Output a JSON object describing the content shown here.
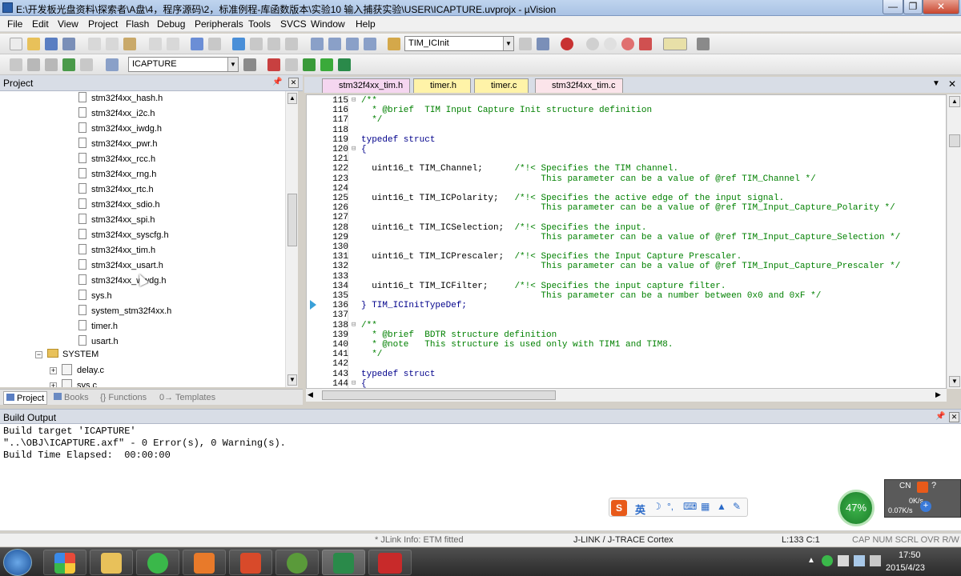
{
  "window": {
    "title": "E:\\开发板光盘资料\\探索者\\A盘\\4，程序源码\\2，标准例程-库函数版本\\实验10 输入捕获实验\\USER\\ICAPTURE.uvprojx - µVision",
    "controls": [
      "—",
      "❐",
      "✕"
    ]
  },
  "menu": [
    "File",
    "Edit",
    "View",
    "Project",
    "Flash",
    "Debug",
    "Peripherals",
    "Tools",
    "SVCS",
    "Window",
    "Help"
  ],
  "toolbar": {
    "find_combo": "TIM_ICInit",
    "target_combo": "ICAPTURE"
  },
  "project_panel": {
    "title": "Project",
    "files": [
      "stm32f4xx_hash.h",
      "stm32f4xx_i2c.h",
      "stm32f4xx_iwdg.h",
      "stm32f4xx_pwr.h",
      "stm32f4xx_rcc.h",
      "stm32f4xx_rng.h",
      "stm32f4xx_rtc.h",
      "stm32f4xx_sdio.h",
      "stm32f4xx_spi.h",
      "stm32f4xx_syscfg.h",
      "stm32f4xx_tim.h",
      "stm32f4xx_usart.h",
      "stm32f4xx_wwdg.h",
      "sys.h",
      "system_stm32f4xx.h",
      "timer.h",
      "usart.h"
    ],
    "folder": "SYSTEM",
    "subfiles": [
      "delay.c",
      "sys.c"
    ],
    "tabs": [
      "Project",
      "Books",
      "{} Functions",
      "0→ Templates"
    ]
  },
  "editor": {
    "tabs": [
      {
        "label": "stm32f4xx_tim.h",
        "color": "#f5d6f0"
      },
      {
        "label": "timer.h",
        "color": "#fff3a8"
      },
      {
        "label": "timer.c",
        "color": "#fff3a8"
      },
      {
        "label": "stm32f4xx_tim.c",
        "color": "#fbe4ea"
      }
    ],
    "line_numbers": [
      "115",
      "116",
      "117",
      "118",
      "119",
      "120",
      "121",
      "122",
      "123",
      "124",
      "125",
      "126",
      "127",
      "128",
      "129",
      "130",
      "131",
      "132",
      "133",
      "134",
      "135",
      "136",
      "137",
      "138",
      "139",
      "140",
      "141",
      "142",
      "143",
      "144"
    ],
    "lines": [
      "/**",
      "  * @brief  TIM Input Capture Init structure definition",
      "  */",
      "",
      "typedef struct",
      "{",
      "",
      "  uint16_t TIM_Channel;      /*!< Specifies the TIM channel.",
      "                                  This parameter can be a value of @ref TIM_Channel */",
      "",
      "  uint16_t TIM_ICPolarity;   /*!< Specifies the active edge of the input signal.",
      "                                  This parameter can be a value of @ref TIM_Input_Capture_Polarity */",
      "",
      "  uint16_t TIM_ICSelection;  /*!< Specifies the input.",
      "                                  This parameter can be a value of @ref TIM_Input_Capture_Selection */",
      "",
      "  uint16_t TIM_ICPrescaler;  /*!< Specifies the Input Capture Prescaler.",
      "                                  This parameter can be a value of @ref TIM_Input_Capture_Prescaler */",
      "",
      "  uint16_t TIM_ICFilter;     /*!< Specifies the input capture filter.",
      "                                  This parameter can be a number between 0x0 and 0xF */",
      "} TIM_ICInitTypeDef;",
      "",
      "/**",
      "  * @brief  BDTR structure definition",
      "  * @note   This structure is used only with TIM1 and TIM8.",
      "  */",
      "",
      "typedef struct",
      "{"
    ]
  },
  "build_output": {
    "title": "Build Output",
    "lines": [
      "Build target 'ICAPTURE'",
      "\"..\\OBJ\\ICAPTURE.axf\" - 0 Error(s), 0 Warning(s).",
      "Build Time Elapsed:  00:00:00"
    ]
  },
  "status": {
    "jlink": "* JLink Info: ETM fitted",
    "debugger": "J-LINK / J-TRACE Cortex",
    "pos": "L:133 C:1",
    "keys": "CAP  NUM  SCRL  OVR  R/W"
  },
  "tray": {
    "gauge": "47%",
    "lang": "CN",
    "net_up": "0K/s",
    "net_down": "0.07K/s",
    "time": "17:50",
    "date": "2015/4/23"
  }
}
